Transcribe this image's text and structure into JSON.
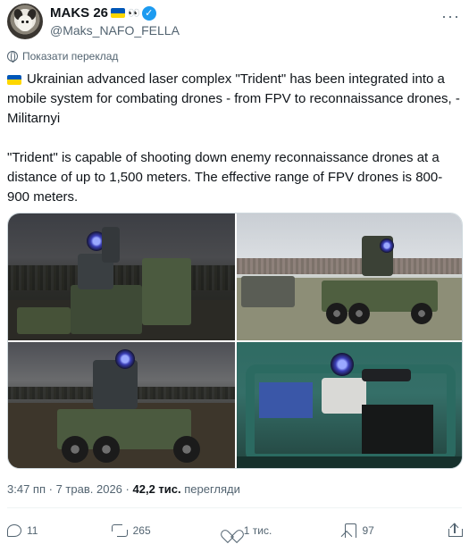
{
  "author": {
    "name": "MAKS 26",
    "emoji_suffix": "👀",
    "handle": "@Maks_NAFO_FELLA",
    "verified": true,
    "flag_colors": [
      "#0057b7",
      "#ffd700"
    ]
  },
  "translate_label": "Показати переклад",
  "tweet": {
    "paragraph1": "Ukrainian advanced laser complex \"Trident\" has been integrated into a mobile system for combating drones - from FPV to reconnaissance drones, - Militarnyi",
    "paragraph2": "\"Trident\" is capable of shooting down enemy reconnaissance drones at a distance of up to 1,500 meters. The effective range of FPV drones is 800-900 meters."
  },
  "media": {
    "count": 4,
    "subjects": [
      "trident-laser-trailer-dusk",
      "trident-trailer-field",
      "trident-trailer-clouds",
      "trident-in-vehicle"
    ]
  },
  "meta": {
    "time": "3:47 пп",
    "separator": "·",
    "date": "7 трав. 2026",
    "views_count": "42,2 тис.",
    "views_label": "перегляди"
  },
  "actions": {
    "replies": "11",
    "reposts": "265",
    "likes": "1 тис.",
    "bookmarks": "97"
  },
  "icons": [
    "more-icon",
    "globe-icon",
    "reply-icon",
    "repost-icon",
    "like-icon",
    "views-icon",
    "bookmark-icon",
    "share-icon"
  ],
  "colors": {
    "text_primary": "#0f1419",
    "text_secondary": "#536471",
    "verified_blue": "#1d9bf0",
    "border": "#cfd9de"
  }
}
